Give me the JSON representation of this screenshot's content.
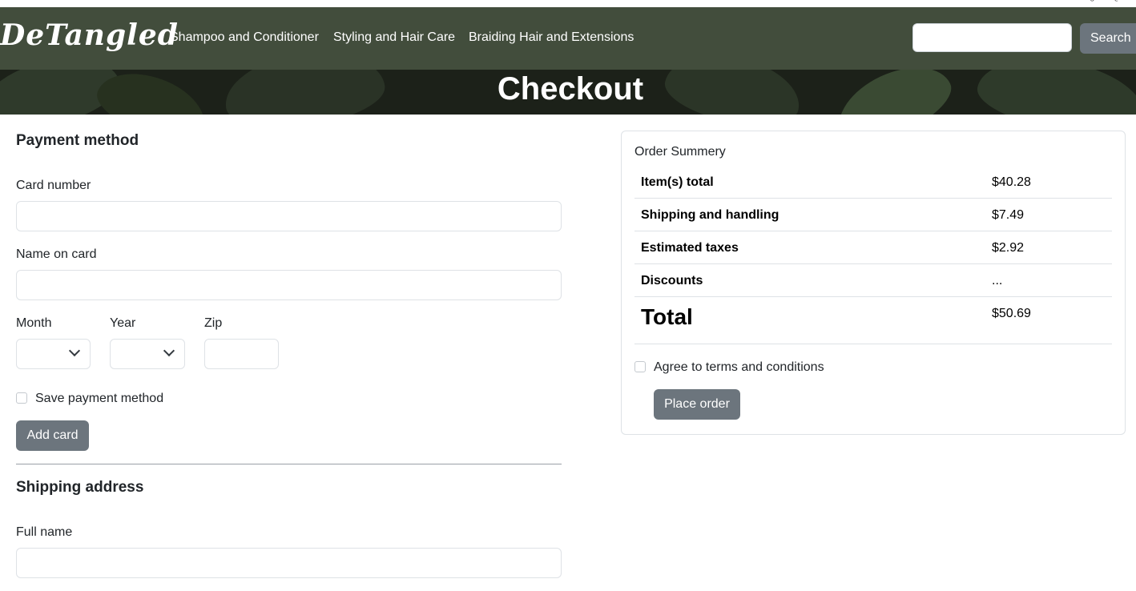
{
  "header": {
    "brand": "DeTangled",
    "nav": [
      "Shampoo and Conditioner",
      "Styling and Hair Care",
      "Braiding Hair and Extensions"
    ],
    "search_placeholder": "",
    "search_label": "Search"
  },
  "hero": {
    "title": "Checkout"
  },
  "payment": {
    "title": "Payment method",
    "card_number_label": "Card number",
    "name_on_card_label": "Name on card",
    "month_label": "Month",
    "year_label": "Year",
    "zip_label": "Zip",
    "save_label": "Save payment method",
    "add_card_label": "Add card"
  },
  "shipping": {
    "title": "Shipping address",
    "full_name_label": "Full name"
  },
  "summary": {
    "title": "Order Summery",
    "rows": [
      {
        "label": "Item(s) total",
        "value": "$40.28"
      },
      {
        "label": "Shipping and handling",
        "value": "$7.49"
      },
      {
        "label": "Estimated taxes",
        "value": "$2.92"
      },
      {
        "label": "Discounts",
        "value": "..."
      }
    ],
    "total_label": "Total",
    "total_value": "$50.69",
    "terms_label": "Agree to terms and conditions",
    "place_order_label": "Place order"
  },
  "colors": {
    "navbar": "#424d3c",
    "button_gray": "#6c757d",
    "hero_bg": "#1c2119"
  }
}
